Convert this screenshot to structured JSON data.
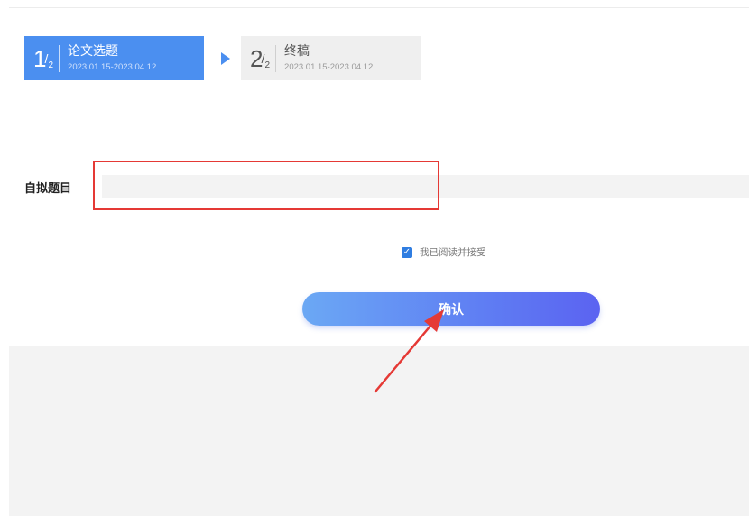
{
  "steps": [
    {
      "number": "1",
      "total": "2",
      "slash": "/",
      "title": "论文选题",
      "date": "2023.01.15-2023.04.12"
    },
    {
      "number": "2",
      "total": "2",
      "slash": "/",
      "title": "终稿",
      "date": "2023.01.15-2023.04.12"
    }
  ],
  "form": {
    "label": "自拟题目",
    "input_value": "",
    "input_placeholder": ""
  },
  "agreement": {
    "checked": true,
    "check_glyph": "✓",
    "text": "我已阅读并接受"
  },
  "confirm_button": {
    "label": "确认"
  },
  "colors": {
    "active_step": "#4b8ff0",
    "inactive_step": "#efefef",
    "annotation": "#e53935",
    "checkbox": "#2f7de1"
  }
}
